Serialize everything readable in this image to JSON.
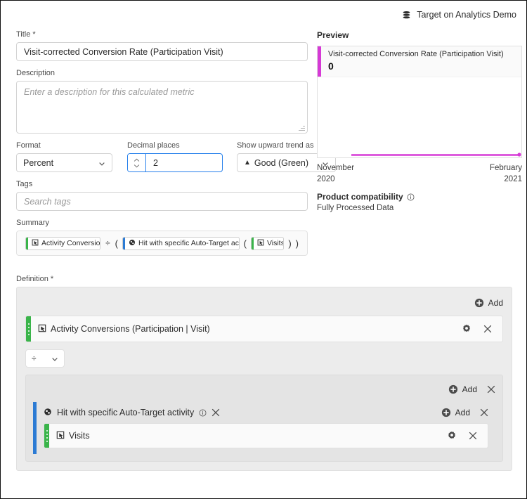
{
  "topbar": {
    "label": "Target on Analytics Demo",
    "icon": "stack-icon"
  },
  "form": {
    "title_label": "Title *",
    "title_value": "Visit-corrected Conversion Rate (Participation Visit)",
    "description_label": "Description",
    "description_placeholder": "Enter a description for this calculated metric",
    "format_label": "Format",
    "format_value": "Percent",
    "decimal_label": "Decimal places",
    "decimal_value": "2",
    "trend_label": "Show upward trend as",
    "trend_value": "Good (Green)",
    "trend_glyph": "▲",
    "tags_label": "Tags",
    "tags_placeholder": "Search tags",
    "summary_label": "Summary",
    "definition_label": "Definition *"
  },
  "summary": {
    "tokens": [
      {
        "kind": "metric",
        "label": "Activity Conversions",
        "color": "#3ab44a",
        "icon": "metric-icon"
      },
      {
        "kind": "operator",
        "label": "÷"
      },
      {
        "kind": "paren",
        "label": "("
      },
      {
        "kind": "segment",
        "label": "Hit with specific Auto-Target activity",
        "color": "#2c7bd4",
        "icon": "segment-icon"
      },
      {
        "kind": "paren",
        "label": "("
      },
      {
        "kind": "metric",
        "label": "Visits",
        "color": "#3ab44a",
        "icon": "metric-icon"
      },
      {
        "kind": "paren",
        "label": ")"
      },
      {
        "kind": "paren",
        "label": ")"
      }
    ]
  },
  "definition": {
    "add_label": "Add",
    "top_metric": {
      "label": "Activity Conversions (Participation | Visit)",
      "accent": "#3ab44a",
      "icon": "metric-icon"
    },
    "operator": {
      "value": "÷"
    },
    "group": {
      "add_label": "Add",
      "segment": {
        "label": "Hit with specific Auto-Target activity",
        "accent": "#2c7bd4",
        "icon": "segment-icon",
        "add_label": "Add"
      },
      "metric": {
        "label": "Visits",
        "accent": "#3ab44a",
        "icon": "metric-icon"
      }
    }
  },
  "preview": {
    "heading": "Preview",
    "metric_name": "Visit-corrected Conversion Rate (Participation Visit)",
    "metric_value": "0",
    "accent": "#d63ad6",
    "date_start_month": "November",
    "date_start_year": "2020",
    "date_end_month": "February",
    "date_end_year": "2021",
    "compatibility_label": "Product compatibility",
    "compatibility_value": "Fully Processed Data"
  },
  "chart_data": {
    "type": "line",
    "title": "Visit-corrected Conversion Rate (Participation Visit)",
    "x": [
      "November 2020",
      "February 2021"
    ],
    "series": [
      {
        "name": "Visit-corrected Conversion Rate (Participation Visit)",
        "values": [
          0,
          0
        ],
        "color": "#d63ad6"
      }
    ],
    "ylim": [
      0,
      1
    ],
    "grid": false,
    "legend": "none",
    "xlabel": "",
    "ylabel": ""
  }
}
